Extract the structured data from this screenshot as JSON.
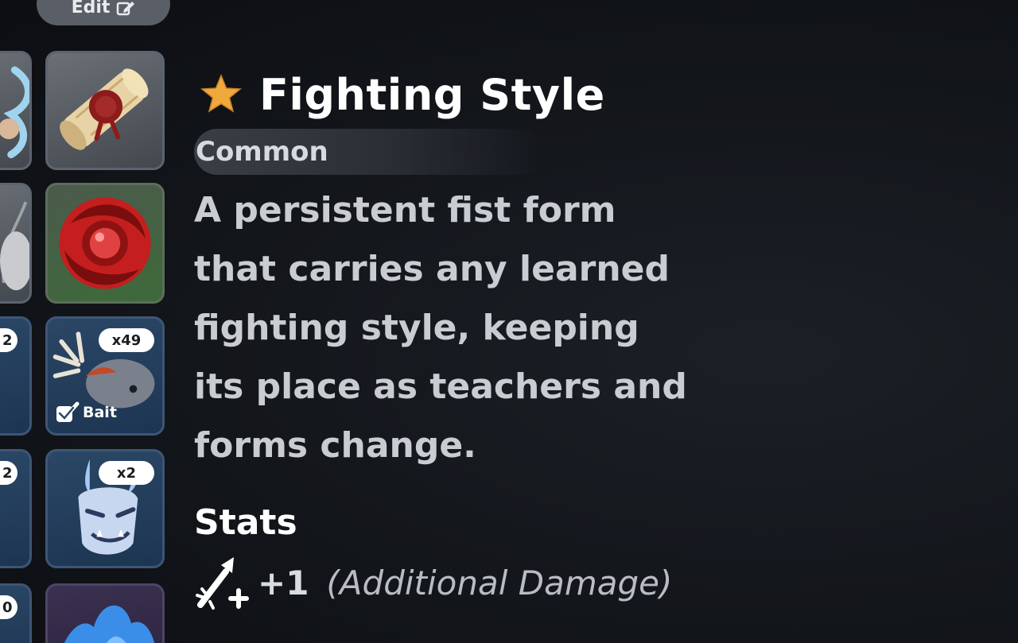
{
  "edit_button": {
    "label": "Edit",
    "icon": "edit-icon"
  },
  "inventory": {
    "slots": [
      {
        "name": "water-spirit-item",
        "badge": ""
      },
      {
        "name": "scroll-item",
        "badge": ""
      },
      {
        "name": "grey-item",
        "badge": ""
      },
      {
        "name": "crimson-orb-item",
        "badge": ""
      },
      {
        "name": "partial-item-3",
        "badge": "2"
      },
      {
        "name": "stag-fish-bait",
        "badge": "x49",
        "tag": "Bait",
        "tag_checked": true
      },
      {
        "name": "partial-item-4",
        "badge": "2"
      },
      {
        "name": "oni-mask-item",
        "badge": "x2"
      },
      {
        "name": "partial-item-5",
        "badge": "0"
      },
      {
        "name": "ice-crystal-item",
        "badge": ""
      }
    ]
  },
  "detail": {
    "title": "Fighting Style",
    "title_icon": "star-icon",
    "rarity": "Common",
    "description_lines": [
      "A persistent fist form",
      "that carries any learned",
      "fighting style, keeping",
      "its place as teachers and",
      "forms change."
    ],
    "stats_heading": "Stats",
    "stats": [
      {
        "icon": "sword-sparkle-icon",
        "value": "+1",
        "label": "(Additional Damage)"
      }
    ]
  },
  "colors": {
    "background": "#14171c",
    "star": "#f2a93b",
    "rarity_bar": "#3a3e45",
    "slot_grey": "#5a5f66",
    "slot_green": "#3d6a3a",
    "slot_blue": "#1c3552",
    "badge": "#ffffff"
  }
}
